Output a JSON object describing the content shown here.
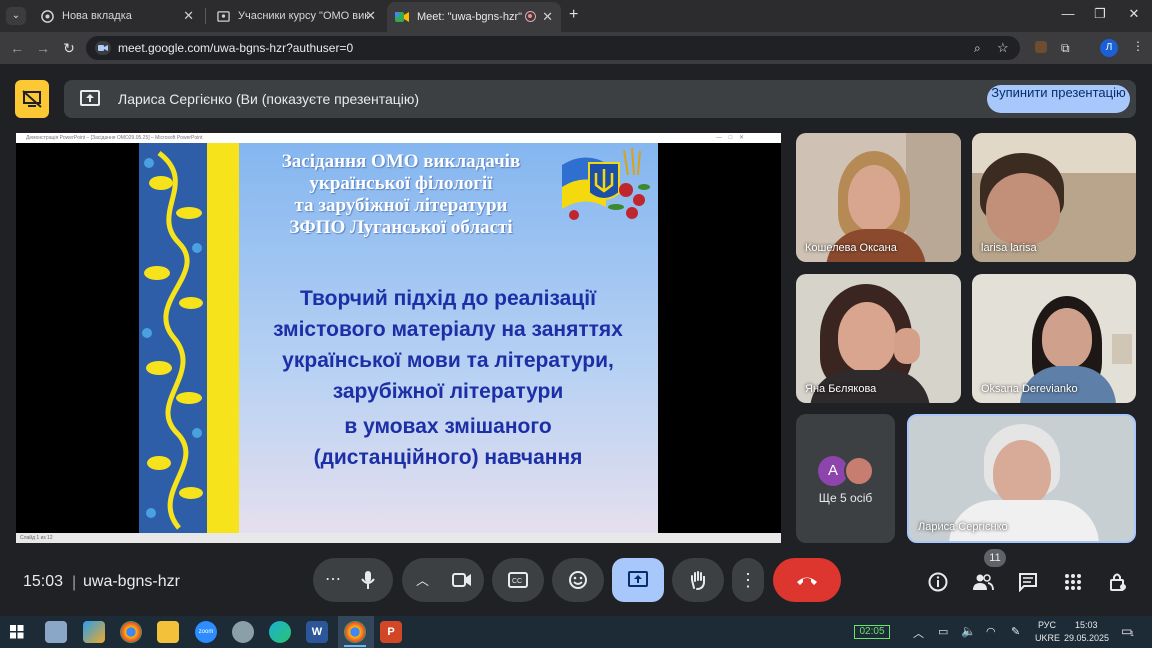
{
  "browser": {
    "tabs": [
      {
        "title": "Нова вкладка"
      },
      {
        "title": "Учасники курсу \"ОМО виклад"
      },
      {
        "title": "Meet: \"uwa-bgns-hzr\""
      }
    ],
    "new_tab": "+",
    "url": "meet.google.com/uwa-bgns-hzr?authuser=0",
    "profile_initial": "Л"
  },
  "meet": {
    "banner_text": "Лариса Сергієнко (Ви (показуєте презентацію)",
    "stop_button": "Зупинити презентацію",
    "slide": {
      "window_title": "Демонстрація PowerPoint – [Засідання ОМО29.05.25] – Microsoft PowerPoint",
      "status": "Слайд 1 из 12",
      "heading_lines": [
        "Засідання ОМО викладачів",
        "української філології",
        "та зарубіжної літератури",
        "ЗФПО Луганської області"
      ],
      "main_lines": [
        "Творчий підхід до реалізації",
        "змістового матеріалу на заняттях",
        "української мови та літератури,",
        "зарубіжної літератури",
        "в умовах змішаного",
        "(дистанційного) навчання"
      ]
    },
    "participants": [
      {
        "name": "Кошелева Оксана"
      },
      {
        "name": "larisa larisa"
      },
      {
        "name": "Яна Бєлякова"
      },
      {
        "name": "Oksana Derevianko"
      }
    ],
    "more": {
      "avatar_letter": "A",
      "label": "Ще 5 осіб"
    },
    "self_tile": {
      "name": "Лариса Сергієнко"
    },
    "time": "15:03",
    "separator": "|",
    "meeting_code": "uwa-bgns-hzr",
    "participants_count": "11",
    "colors": {
      "accent": "#a8c7fa",
      "end_call": "#dc362e",
      "present_active": "#a8c7fa",
      "highlight": "#fcc934"
    }
  },
  "taskbar": {
    "zoom_label": "zoom",
    "rec_time": "02:05",
    "lang": "РУС",
    "lang2": "UKRE",
    "time": "15:03",
    "date": "29.05.2025",
    "notif_count": "1"
  }
}
